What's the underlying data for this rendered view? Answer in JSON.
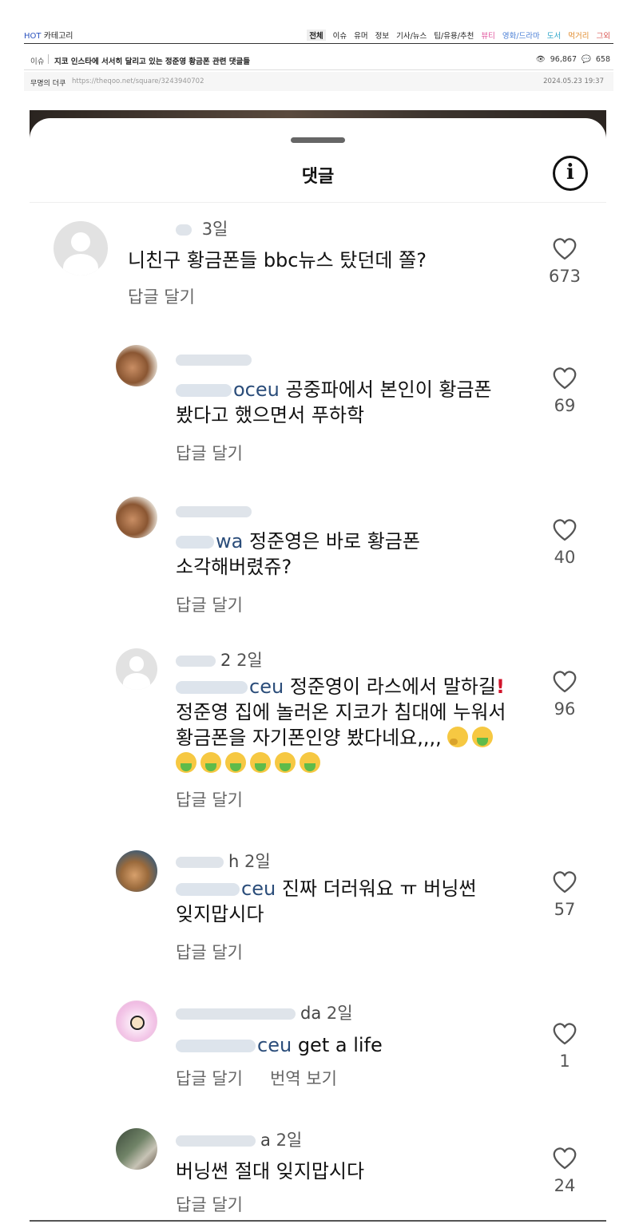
{
  "header": {
    "hot_prefix": "HOT",
    "hot_label": "카테고리",
    "categories": [
      {
        "label": "전체",
        "color": "#222222",
        "active": true
      },
      {
        "label": "이슈",
        "color": "#222222"
      },
      {
        "label": "유머",
        "color": "#222222"
      },
      {
        "label": "정보",
        "color": "#222222"
      },
      {
        "label": "기사/뉴스",
        "color": "#222222"
      },
      {
        "label": "팁/유용/추천",
        "color": "#222222"
      },
      {
        "label": "뷰티",
        "color": "#e0529c"
      },
      {
        "label": "영화/드라마",
        "color": "#4a7fd6"
      },
      {
        "label": "도서",
        "color": "#2aa4c8"
      },
      {
        "label": "먹거리",
        "color": "#e08a2a"
      },
      {
        "label": "그외",
        "color": "#d9534f"
      }
    ]
  },
  "post": {
    "board": "이슈",
    "title": "지코 인스타에 서서히 달리고 있는 정준영 황금폰 관련 댓글들",
    "views": "96,867",
    "comments": "658",
    "author": "무명의 더쿠",
    "url": "https://theqoo.net/square/3243940702",
    "date": "2024.05.23 19:37"
  },
  "sheet": {
    "title": "댓글",
    "reply_label": "답글 달기",
    "translate_label": "번역 보기"
  },
  "comments": [
    {
      "user_tail": "",
      "age": "3일",
      "mention_tail": "",
      "text": "니친구 황금폰들 bbc뉴스 탔던데 쫄?",
      "likes": "673"
    },
    {
      "user_tail": "",
      "age": "",
      "mention_tail": "oceu",
      "text1": "공중파에서 본인이 황금폰",
      "text2": "봤다고 했으면서 푸하학",
      "likes": "69"
    },
    {
      "user_tail": "",
      "age": "",
      "mention_tail": "wa",
      "text1": "정준영은 바로 황금폰",
      "text2": "소각해버렸쥬?",
      "likes": "40"
    },
    {
      "user_tail": "2",
      "age": "2일",
      "mention_tail": "ceu",
      "text1": "정준영이 라스에서 말하길",
      "text2": "정준영 집에 놀러온 지코가 침대에 누워서",
      "text3": "황금폰을 자기폰인양 봤다네요,,,,",
      "likes": "96"
    },
    {
      "user_tail": "h",
      "age": "2일",
      "mention_tail": "ceu",
      "text1": "진짜 더러워요 ㅠ 버닝썬",
      "text2": "잊지맙시다",
      "likes": "57"
    },
    {
      "user_tail": "da",
      "age": "2일",
      "mention_tail": "ceu",
      "text": "get a life",
      "likes": "1"
    },
    {
      "user_tail": "a",
      "age": "2일",
      "mention_tail": "",
      "text": "버닝썬 절대 잊지맙시다",
      "likes": "24"
    }
  ]
}
